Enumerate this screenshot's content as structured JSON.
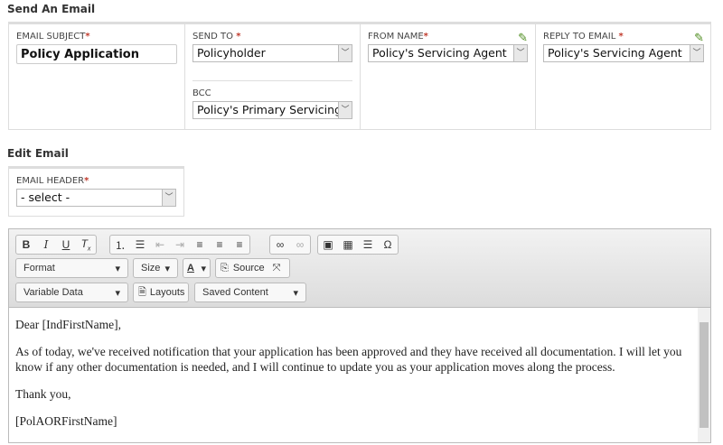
{
  "send": {
    "title": "Send An Email",
    "subject_label": "EMAIL SUBJECT",
    "subject_value": "Policy Application",
    "send_to_label": "SEND TO",
    "send_to_value": "Policyholder",
    "bcc_label": "BCC",
    "bcc_value": "Policy's Primary Servicing Agent",
    "from_label": "FROM NAME",
    "from_value": "Policy's Servicing Agent",
    "reply_label": "REPLY TO EMAIL",
    "reply_value": "Policy's Servicing Agent",
    "req": "*"
  },
  "edit": {
    "title": "Edit Email",
    "header_label": "EMAIL HEADER",
    "header_value": "- select -"
  },
  "toolbar": {
    "format": "Format",
    "size": "Size",
    "color": "A",
    "source": "Source",
    "variable": "Variable Data",
    "layouts": "Layouts",
    "saved": "Saved Content"
  },
  "body": {
    "p1": "Dear [IndFirstName],",
    "p2": "As of today, we've received notification that your application has been approved and they have received all documentation. I will let you know if any other documentation is needed, and I will continue to update you as your application moves along the process.",
    "p3": "Thank you,",
    "p4": "[PolAORFirstName]"
  }
}
